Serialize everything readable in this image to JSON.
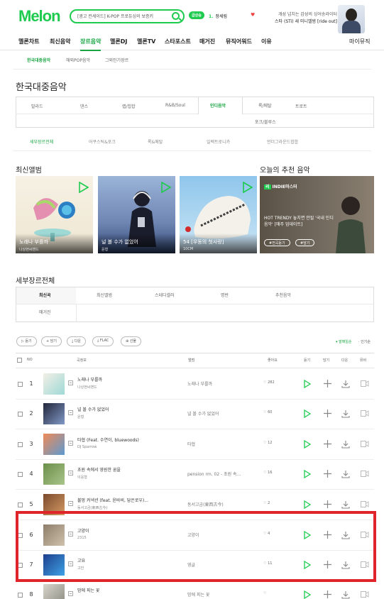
{
  "header": {
    "logo": "Melon",
    "search_text": "[광고 컨세이드] K-POP 프로듀싱의 보증키",
    "pill": "급상승",
    "rank_num": "1.",
    "rank_text": "장세림",
    "promo_line1": "개성 넘치는 감성의 싱어송라이터",
    "promo_line2": "스타 (STi) 새 미니앨범 [ride out]"
  },
  "gnb": [
    "멜론차트",
    "최신음악",
    "장르음악",
    "멜론DJ",
    "멜론TV",
    "스타포스트",
    "매거진",
    "뮤직어워드",
    "이유",
    "마이뮤직"
  ],
  "subnav": [
    "한국대중음악",
    "해외POP음악",
    "그외인기장르"
  ],
  "page_title": "한국대중음악",
  "genres_row1": [
    "발라드",
    "댄스",
    "랩/힙합",
    "R&B/Soul",
    "인디음악",
    "록/메탈",
    "트로트"
  ],
  "genres_row2": [
    "포크/블루스"
  ],
  "subgenres": [
    "세부장르전체",
    "어쿠스틱&포크",
    "록&메탈",
    "일렉트로니카",
    "언더그라운드힙합"
  ],
  "latest_title": "최신앨범",
  "albums": [
    {
      "title": "노래나 부를까",
      "artist": "나상현씨밴드"
    },
    {
      "title": "널 볼 수가 없었어",
      "artist": "윤형"
    },
    {
      "title": "54 [우동의 첫사랑]",
      "artist": "10CM"
    }
  ],
  "reco_title": "오늘의 추천 음악",
  "reco": {
    "tag_badge": "리",
    "tag": "INDIE마스터",
    "headline": "HOT TRENDY 놓치면 안될 '국내 인디음악' [매주 업데이트]",
    "btn1": "#전곡듣기",
    "btn2": "#담기"
  },
  "all_title": "세부장르전체",
  "tabs_row1": [
    "최신곡",
    "최신앨범",
    "스테디셀러",
    "명반",
    "추천음악"
  ],
  "tabs_row2": [
    "매거진"
  ],
  "actions": [
    "듣기",
    "담기",
    "다운",
    "FLAC",
    "선물"
  ],
  "sorts": [
    "발매일순",
    "인기순"
  ],
  "columns": [
    "NO",
    "곡정보",
    "앨범",
    "좋아요",
    "듣기",
    "담기",
    "다운",
    "뮤비"
  ],
  "rows": [
    {
      "no": "1",
      "title": "노래나 부를까",
      "artist": "나상현씨밴드",
      "album": "노래나 부를까",
      "likes": "282"
    },
    {
      "no": "2",
      "title": "널 볼 수가 없었어",
      "artist": "윤형",
      "album": "널 볼 수가 없었어",
      "likes": "60"
    },
    {
      "no": "3",
      "title": "타협 (Feat. 수연이, bluewoods)",
      "artist": "DJ Sparrow",
      "album": "타협",
      "likes": "12"
    },
    {
      "no": "4",
      "title": "초원 속에서 영원한 꿈을",
      "artist": "이웅형",
      "album": "pension rm. 02 - 초원 속...",
      "likes": "16"
    },
    {
      "no": "5",
      "title": "불멍 커넥션 (feat. 윤바비, 담은로우)...",
      "artist": "동서고금(東西古今)",
      "album": "동서고금(東西古今)",
      "likes": "2"
    },
    {
      "no": "6",
      "title": "고양이",
      "artist": "2315",
      "album": "고양이",
      "likes": "4"
    },
    {
      "no": "7",
      "title": "고요",
      "artist": "고잔",
      "album": "영글",
      "likes": "11"
    },
    {
      "no": "8",
      "title": "밤에 피는 꽃",
      "artist": "",
      "album": "밤에 피는 꽃",
      "likes": ""
    }
  ],
  "colors": {
    "accent": "#1ecb4f",
    "highlight": "#e0252a"
  }
}
